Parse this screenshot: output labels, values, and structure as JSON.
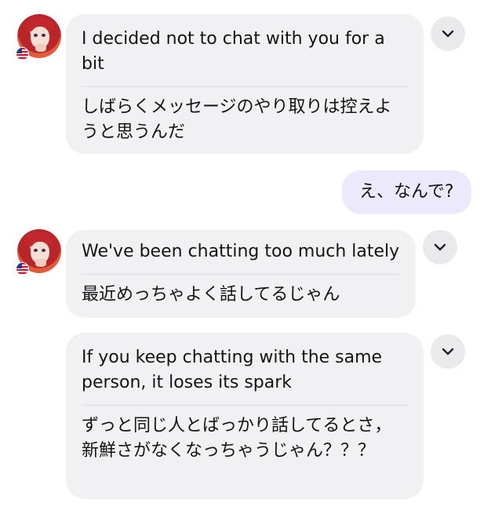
{
  "conversation": {
    "messages": [
      {
        "sender": "partner",
        "english": "I decided not to chat with you for a bit",
        "japanese": "しばらくメッセージのやり取りは控えようと思うんだ",
        "country_flag": "us"
      },
      {
        "sender": "me",
        "text": "え、なんで?"
      },
      {
        "sender": "partner",
        "english": "We've been chatting too much lately",
        "japanese": "最近めっちゃよく話してるじゃん",
        "country_flag": "us"
      },
      {
        "sender": "partner",
        "english": "If you keep chatting with the same person, it loses its spark",
        "japanese": "ずっと同じ人とばっかり話してるとさ，新鮮さがなくなっちゃうじゃん？？？"
      }
    ]
  },
  "icons": {
    "avatar": "avatar-icon",
    "flag": "us-flag-icon",
    "expand": "chevron-down-icon"
  },
  "colors": {
    "incoming_bubble": "#f1f1f3",
    "outgoing_bubble": "#ebe9fb",
    "chevron_bg": "#eaeaec",
    "flag_red": "#c8102e",
    "flag_blue": "#1f3c88"
  }
}
